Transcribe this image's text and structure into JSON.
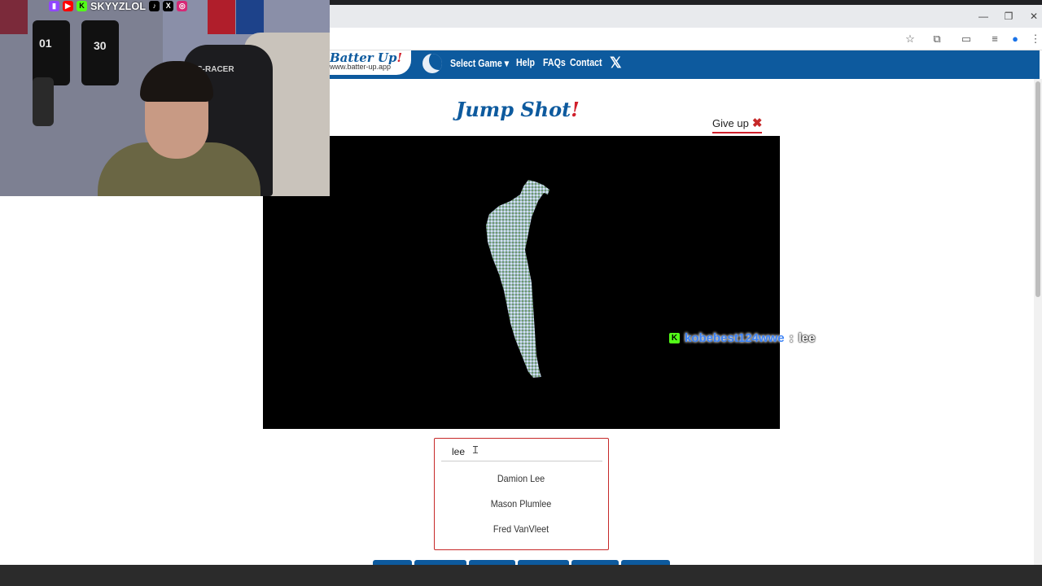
{
  "webcam": {
    "streamer_handle": "SKYYZLOL",
    "chair_brand": "S-RACER",
    "jersey_numbers": [
      "01",
      "30"
    ],
    "social_icons": [
      "twitch-icon",
      "youtube-icon",
      "kick-icon",
      "tiktok-icon",
      "x-icon",
      "instagram-icon"
    ]
  },
  "site": {
    "logo_title": "Batter Up",
    "logo_bang": "!",
    "logo_url": "www.batter-up.app",
    "nav": {
      "select_game": "Select Game ▾",
      "help": "Help",
      "faqs": "FAQs",
      "contact": "Contact",
      "x": "𝕏"
    }
  },
  "game": {
    "title": "Jump Shot",
    "title_bang": "!",
    "give_up": "Give up",
    "give_up_icon": "✖",
    "search_value": "lee",
    "suggestions": [
      "Damion Lee",
      "Mason Plumlee",
      "Fred VanVleet"
    ]
  },
  "chat": {
    "user": "kobebest124wwe",
    "separator": ":",
    "message": "lee"
  },
  "colors": {
    "brand_blue": "#0d5a9e",
    "accent_red": "#d01f2b",
    "kick_green": "#53fc18"
  }
}
